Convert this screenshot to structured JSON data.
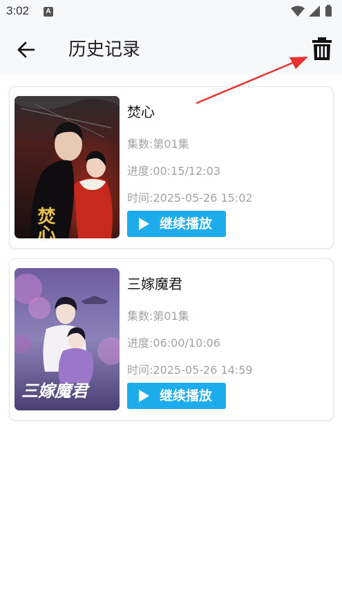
{
  "status_bar": {
    "time": "3:02",
    "notification_letter": "A"
  },
  "header": {
    "title": "历史记录"
  },
  "history": [
    {
      "title": "焚心",
      "episodes": "集数:第01集",
      "progress": "进度:00:15/12:03",
      "time": "时间:2025-05-26 15:02",
      "continue_label": "继续播放",
      "poster_caption": "焚心"
    },
    {
      "title": "三嫁魔君",
      "episodes": "集数:第01集",
      "progress": "进度:06:00/10:06",
      "time": "时间:2025-05-26 14:59",
      "continue_label": "继续播放",
      "poster_caption": "三嫁魔君"
    }
  ],
  "colors": {
    "accent": "#1caceb",
    "annotation_arrow": "#e8322d",
    "secondary_text": "#a3a3a3"
  }
}
